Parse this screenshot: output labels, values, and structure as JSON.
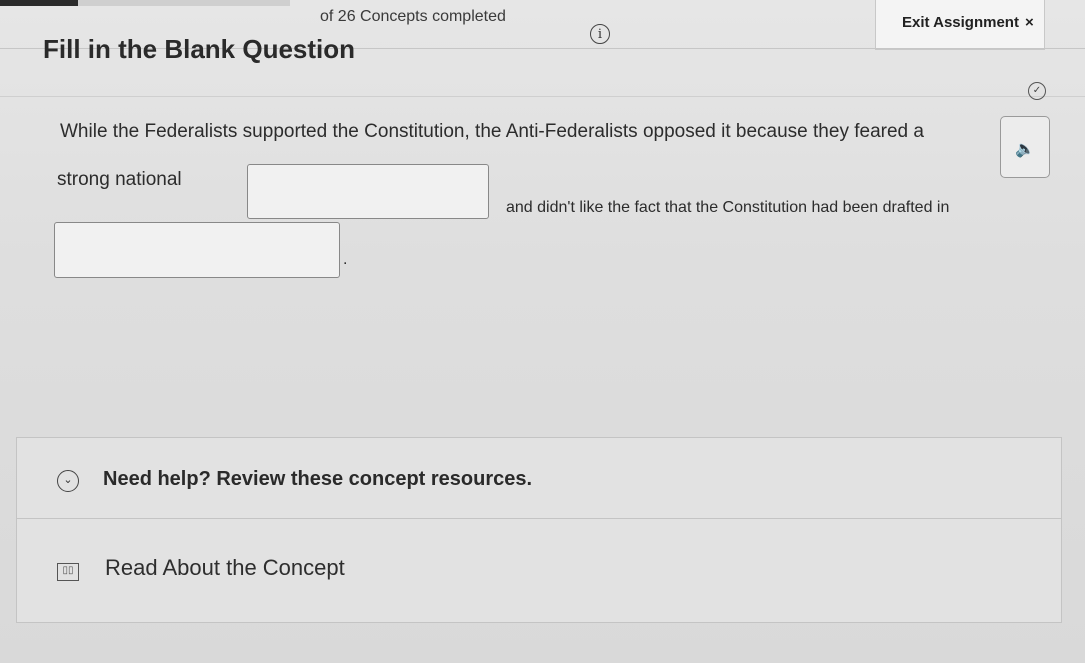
{
  "header": {
    "progress": 0.27,
    "concepts_label": "of 26 Concepts completed",
    "info_icon": "info-icon",
    "exit_label": "Exit Assignment",
    "exit_icon": "×"
  },
  "question": {
    "title": "Fill in the Blank Question",
    "text_part1": "While the Federalists supported the Constitution, the Anti-Federalists opposed it because they feared a",
    "text_part2": "strong national",
    "text_part3": "and didn't like the fact that the Constitution had been drafted in",
    "text_part4": ".",
    "blank1_value": "",
    "blank2_value": ""
  },
  "help": {
    "title": "Need help? Review these concept resources.",
    "resource_label": "Read About the Concept"
  },
  "icons": {
    "check": "check-circle-icon",
    "speaker": "speaker-icon",
    "chevron": "chevron-down-icon",
    "book": "book-icon"
  },
  "colors": {
    "background": "#dcdcdc",
    "text": "#2b2b2b",
    "border": "#888888"
  }
}
